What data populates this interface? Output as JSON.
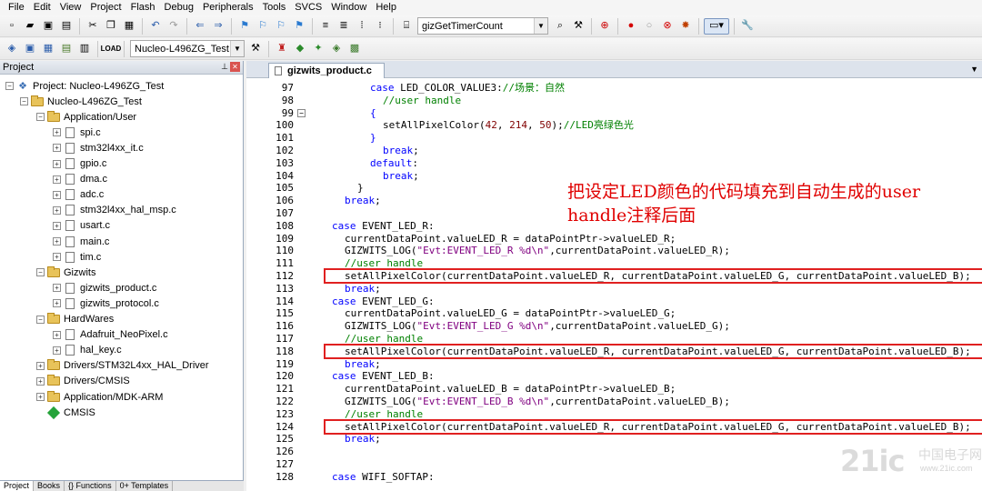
{
  "menubar": [
    "File",
    "Edit",
    "View",
    "Project",
    "Flash",
    "Debug",
    "Peripherals",
    "Tools",
    "SVCS",
    "Window",
    "Help"
  ],
  "toolbar1": {
    "find_combo": "gizGetTimerCount"
  },
  "toolbar2": {
    "target_combo": "Nucleo-L496ZG_Test"
  },
  "project_panel": {
    "title": "Project",
    "tree": [
      {
        "label": "Project: Nucleo-L496ZG_Test",
        "type": "project",
        "exp": "−"
      },
      {
        "label": "Nucleo-L496ZG_Test",
        "type": "folder",
        "exp": "−"
      },
      {
        "label": "Application/User",
        "type": "folder",
        "exp": "−"
      },
      {
        "label": "spi.c",
        "type": "file",
        "exp": "+"
      },
      {
        "label": "stm32l4xx_it.c",
        "type": "file",
        "exp": "+"
      },
      {
        "label": "gpio.c",
        "type": "file",
        "exp": "+"
      },
      {
        "label": "dma.c",
        "type": "file",
        "exp": "+"
      },
      {
        "label": "adc.c",
        "type": "file",
        "exp": "+"
      },
      {
        "label": "stm32l4xx_hal_msp.c",
        "type": "file",
        "exp": "+"
      },
      {
        "label": "usart.c",
        "type": "file",
        "exp": "+"
      },
      {
        "label": "main.c",
        "type": "file",
        "exp": "+"
      },
      {
        "label": "tim.c",
        "type": "file",
        "exp": "+"
      },
      {
        "label": "Gizwits",
        "type": "folder",
        "exp": "−"
      },
      {
        "label": "gizwits_product.c",
        "type": "file",
        "exp": "+"
      },
      {
        "label": "gizwits_protocol.c",
        "type": "file",
        "exp": "+"
      },
      {
        "label": "HardWares",
        "type": "folder",
        "exp": "−"
      },
      {
        "label": "Adafruit_NeoPixel.c",
        "type": "file",
        "exp": "+"
      },
      {
        "label": "hal_key.c",
        "type": "file",
        "exp": "+"
      },
      {
        "label": "Drivers/STM32L4xx_HAL_Driver",
        "type": "folder",
        "exp": "+"
      },
      {
        "label": "Drivers/CMSIS",
        "type": "folder",
        "exp": "+"
      },
      {
        "label": "Application/MDK-ARM",
        "type": "folder",
        "exp": "+"
      },
      {
        "label": "CMSIS",
        "type": "cmsis",
        "exp": ""
      }
    ],
    "bottom_tabs": [
      "Project",
      "Books",
      "{} Functions",
      "0+ Templates"
    ]
  },
  "editor": {
    "active_tab": "gizwits_product.c",
    "lines": [
      {
        "n": "97",
        "indent": 4,
        "parts": [
          [
            "kw",
            "case "
          ],
          [
            "",
            "LED_COLOR_VALUE3:"
          ],
          [
            "cm",
            "//场景：自然"
          ]
        ]
      },
      {
        "n": "98",
        "indent": 5,
        "parts": [
          [
            "cm",
            "//user handle"
          ]
        ]
      },
      {
        "n": "99",
        "indent": 4,
        "parts": [
          [
            "kw",
            "{"
          ]
        ],
        "fold": "−"
      },
      {
        "n": "100",
        "indent": 5,
        "parts": [
          [
            "",
            "setAllPixelColor("
          ],
          [
            "nm",
            "42"
          ],
          [
            "",
            ", "
          ],
          [
            "nm",
            "214"
          ],
          [
            "",
            ", "
          ],
          [
            "nm",
            "50"
          ],
          [
            "",
            ");"
          ],
          [
            "cm",
            "//LED亮绿色光"
          ]
        ]
      },
      {
        "n": "101",
        "indent": 4,
        "parts": [
          [
            "kw",
            "}"
          ]
        ]
      },
      {
        "n": "102",
        "indent": 5,
        "parts": [
          [
            "kw",
            "break"
          ],
          [
            "",
            ";"
          ]
        ]
      },
      {
        "n": "103",
        "indent": 4,
        "parts": [
          [
            "kw",
            "default"
          ],
          [
            "",
            ":"
          ]
        ]
      },
      {
        "n": "104",
        "indent": 5,
        "parts": [
          [
            "kw",
            "break"
          ],
          [
            "",
            ";"
          ]
        ]
      },
      {
        "n": "105",
        "indent": 3,
        "parts": [
          [
            "",
            "}"
          ]
        ]
      },
      {
        "n": "106",
        "indent": 2,
        "parts": [
          [
            "kw",
            "break"
          ],
          [
            "",
            ";"
          ]
        ]
      },
      {
        "n": "107",
        "indent": 0,
        "parts": []
      },
      {
        "n": "108",
        "indent": 1,
        "parts": [
          [
            "kw",
            "case "
          ],
          [
            "",
            "EVENT_LED_R:"
          ]
        ]
      },
      {
        "n": "109",
        "indent": 2,
        "parts": [
          [
            "",
            "currentDataPoint.valueLED_R = dataPointPtr->valueLED_R;"
          ]
        ]
      },
      {
        "n": "110",
        "indent": 2,
        "parts": [
          [
            "",
            "GIZWITS_LOG("
          ],
          [
            "st",
            "\"Evt:EVENT_LED_R %d\\n\""
          ],
          [
            "",
            ",currentDataPoint.valueLED_R);"
          ]
        ]
      },
      {
        "n": "111",
        "indent": 2,
        "parts": [
          [
            "cm",
            "//user handle"
          ]
        ]
      },
      {
        "n": "112",
        "indent": 2,
        "parts": [
          [
            "",
            "setAllPixelColor(currentDataPoint.valueLED_R, currentDataPoint.valueLED_G, currentDataPoint.valueLED_B);"
          ]
        ]
      },
      {
        "n": "113",
        "indent": 2,
        "parts": [
          [
            "kw",
            "break"
          ],
          [
            "",
            ";"
          ]
        ]
      },
      {
        "n": "114",
        "indent": 1,
        "parts": [
          [
            "kw",
            "case "
          ],
          [
            "",
            "EVENT_LED_G:"
          ]
        ]
      },
      {
        "n": "115",
        "indent": 2,
        "parts": [
          [
            "",
            "currentDataPoint.valueLED_G = dataPointPtr->valueLED_G;"
          ]
        ]
      },
      {
        "n": "116",
        "indent": 2,
        "parts": [
          [
            "",
            "GIZWITS_LOG("
          ],
          [
            "st",
            "\"Evt:EVENT_LED_G %d\\n\""
          ],
          [
            "",
            ",currentDataPoint.valueLED_G);"
          ]
        ]
      },
      {
        "n": "117",
        "indent": 2,
        "parts": [
          [
            "cm",
            "//user handle"
          ]
        ]
      },
      {
        "n": "118",
        "indent": 2,
        "parts": [
          [
            "",
            "setAllPixelColor(currentDataPoint.valueLED_R, currentDataPoint.valueLED_G, currentDataPoint.valueLED_B);"
          ]
        ]
      },
      {
        "n": "119",
        "indent": 2,
        "parts": [
          [
            "kw",
            "break"
          ],
          [
            "",
            ";"
          ]
        ]
      },
      {
        "n": "120",
        "indent": 1,
        "parts": [
          [
            "kw",
            "case "
          ],
          [
            "",
            "EVENT_LED_B:"
          ]
        ]
      },
      {
        "n": "121",
        "indent": 2,
        "parts": [
          [
            "",
            "currentDataPoint.valueLED_B = dataPointPtr->valueLED_B;"
          ]
        ]
      },
      {
        "n": "122",
        "indent": 2,
        "parts": [
          [
            "",
            "GIZWITS_LOG("
          ],
          [
            "st",
            "\"Evt:EVENT_LED_B %d\\n\""
          ],
          [
            "",
            ",currentDataPoint.valueLED_B);"
          ]
        ]
      },
      {
        "n": "123",
        "indent": 2,
        "parts": [
          [
            "cm",
            "//user handle"
          ]
        ]
      },
      {
        "n": "124",
        "indent": 2,
        "parts": [
          [
            "",
            "setAllPixelColor(currentDataPoint.valueLED_R, currentDataPoint.valueLED_G, currentDataPoint.valueLED_B);"
          ]
        ]
      },
      {
        "n": "125",
        "indent": 2,
        "parts": [
          [
            "kw",
            "break"
          ],
          [
            "",
            ";"
          ]
        ]
      },
      {
        "n": "126",
        "indent": 0,
        "parts": []
      },
      {
        "n": "127",
        "indent": 0,
        "parts": []
      },
      {
        "n": "128",
        "indent": 1,
        "parts": [
          [
            "kw",
            "case "
          ],
          [
            "",
            "WIFI_SOFTAP:"
          ]
        ]
      }
    ],
    "highlighted_lines": [
      "112",
      "118",
      "124"
    ]
  },
  "annotation": "把设定LED颜色的代码填充到自动生成的user handle注释后面",
  "watermark": {
    "logo": "21ic",
    "cn": "中国电子网",
    "url": "www.21ic.com"
  },
  "colors": {
    "keyword": "#0000ff",
    "comment": "#008000",
    "string": "#800080",
    "number": "#800000",
    "highlight": "#e02020",
    "annotation": "#e00000"
  }
}
